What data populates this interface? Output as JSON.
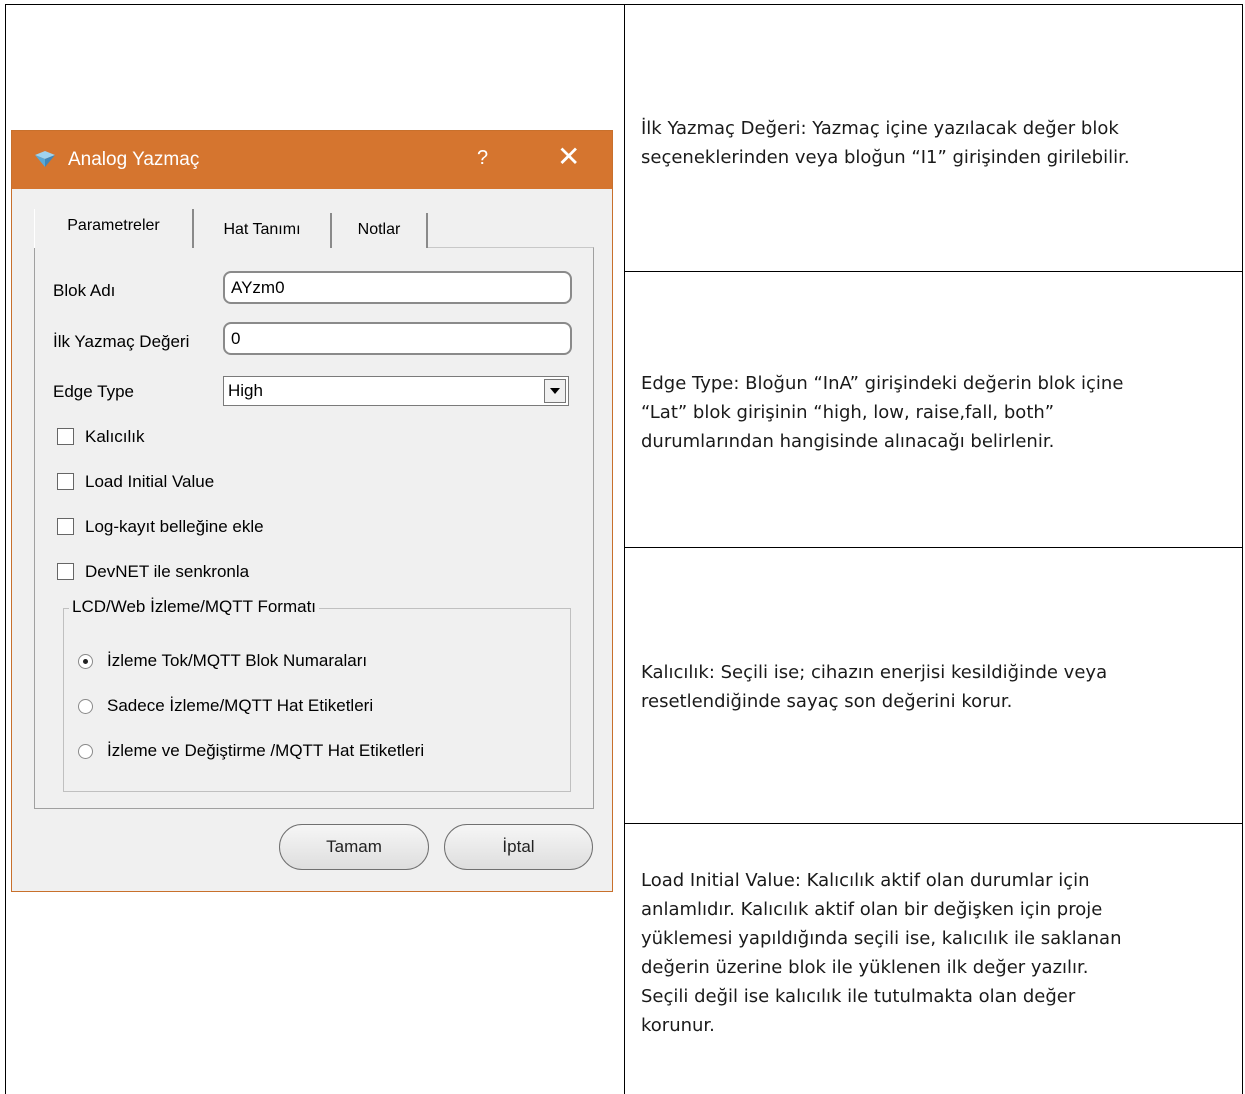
{
  "dialog": {
    "title": "Analog Yazmaç",
    "help": "?",
    "close": "✕",
    "tabs": [
      {
        "label": "Parametreler",
        "active": true
      },
      {
        "label": "Hat Tanımı",
        "active": false
      },
      {
        "label": "Notlar",
        "active": false
      }
    ],
    "fields": {
      "block_name_label": "Blok Adı",
      "block_name_value": "AYzm0",
      "initial_value_label": "İlk Yazmaç Değeri",
      "initial_value_value": "0",
      "edge_type_label": "Edge Type",
      "edge_type_value": "High"
    },
    "checkboxes": [
      {
        "label": "Kalıcılık",
        "checked": false
      },
      {
        "label": "Load Initial Value",
        "checked": false
      },
      {
        "label": "Log-kayıt belleğine ekle",
        "checked": false
      },
      {
        "label": "DevNET ile senkronla",
        "checked": false
      }
    ],
    "group": {
      "label": "LCD/Web İzleme/MQTT Formatı",
      "options": [
        {
          "label": "İzleme Tok/MQTT Blok Numaraları",
          "selected": true
        },
        {
          "label": "Sadece İzleme/MQTT Hat Etiketleri",
          "selected": false
        },
        {
          "label": "İzleme ve Değiştirme /MQTT Hat Etiketleri",
          "selected": false
        }
      ]
    },
    "buttons": {
      "ok": "Tamam",
      "cancel": "İptal"
    },
    "colors": {
      "titlebar": "#d5752f"
    }
  },
  "descriptions": [
    {
      "lines": [
        "İlk Yazmaç Değeri:  Yazmaç içine yazılacak değer blok",
        "seçeneklerinden veya bloğun “I1” girişinden girilebilir."
      ]
    },
    {
      "lines": [
        "Edge Type:  Bloğun “InA” girişindeki değerin blok içine",
        "“Lat” blok girişinin “high, low, raise,fall, both”",
        "durumlarından hangisinde alınacağı belirlenir."
      ]
    },
    {
      "lines": [
        "Kalıcılık:  Seçili ise; cihazın enerjisi kesildiğinde veya",
        "resetlendiğinde sayaç son değerini korur."
      ]
    },
    {
      "lines": [
        "Load Initial Value:  Kalıcılık aktif olan durumlar için",
        "anlamlıdır. Kalıcılık aktif olan bir değişken için proje",
        "yüklemesi yapıldığında seçili ise, kalıcılık ile saklanan",
        "değerin üzerine blok ile yüklenen ilk değer yazılır.",
        "Seçili değil ise kalıcılık ile tutulmakta olan değer",
        "korunur."
      ]
    }
  ]
}
